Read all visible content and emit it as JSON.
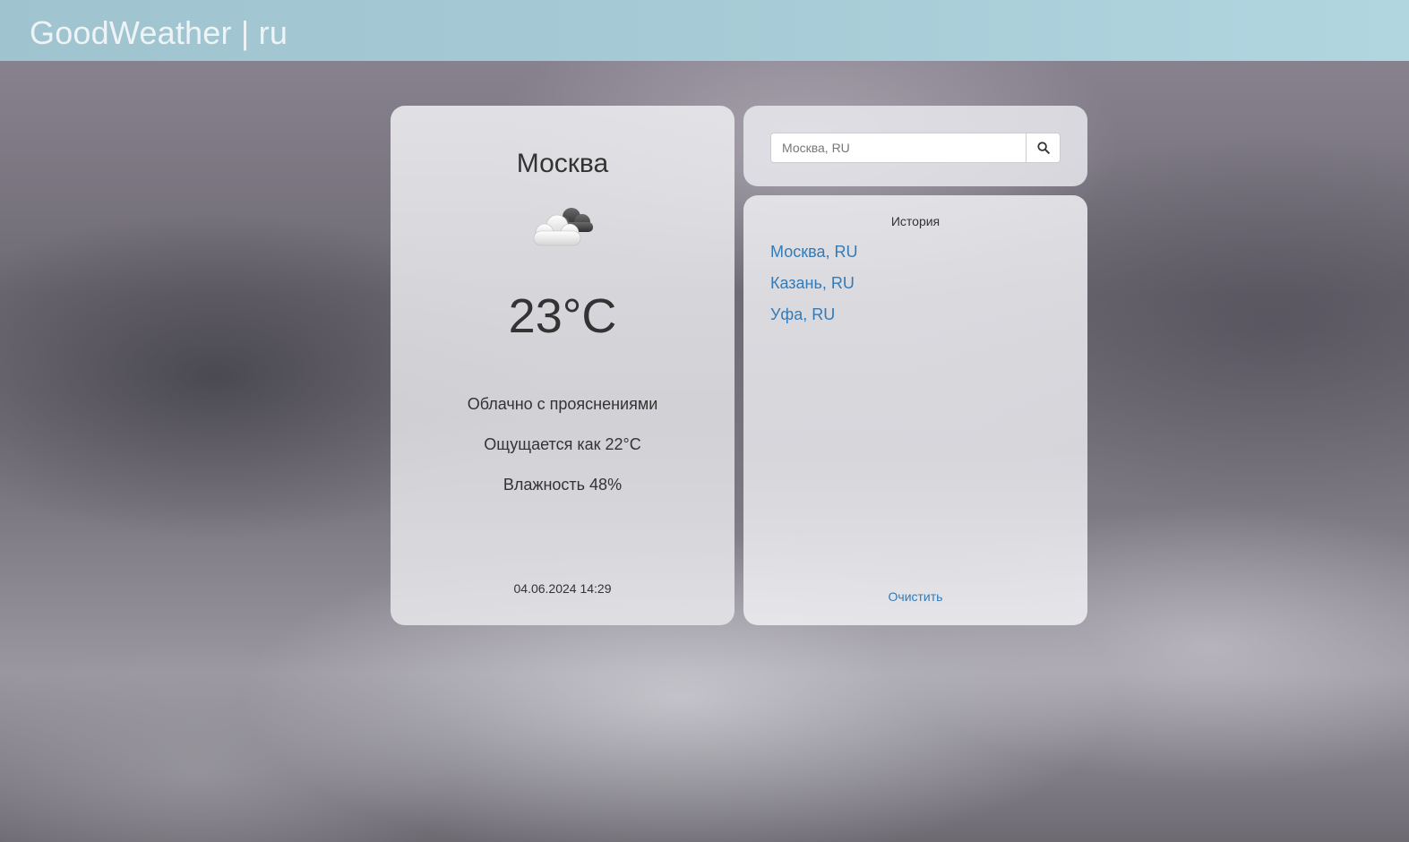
{
  "app": {
    "brand": "GoodWeather | ru"
  },
  "weather": {
    "city": "Москва",
    "icon": "partly-cloudy-icon",
    "temperature": "23°C",
    "description": "Облачно с прояснениями",
    "feels_like": "Ощущается как 22°C",
    "humidity": "Влажность 48%",
    "updated": "04.06.2024 14:29"
  },
  "search": {
    "placeholder": "Москва, RU",
    "value": "",
    "button_icon": "search-icon"
  },
  "history": {
    "title": "История",
    "items": [
      {
        "label": "Москва, RU"
      },
      {
        "label": "Казань, RU"
      },
      {
        "label": "Уфа, RU"
      }
    ],
    "clear_label": "Очистить"
  },
  "colors": {
    "navbar": "#a7cbd6",
    "link": "#337ab7",
    "text": "#333333"
  }
}
